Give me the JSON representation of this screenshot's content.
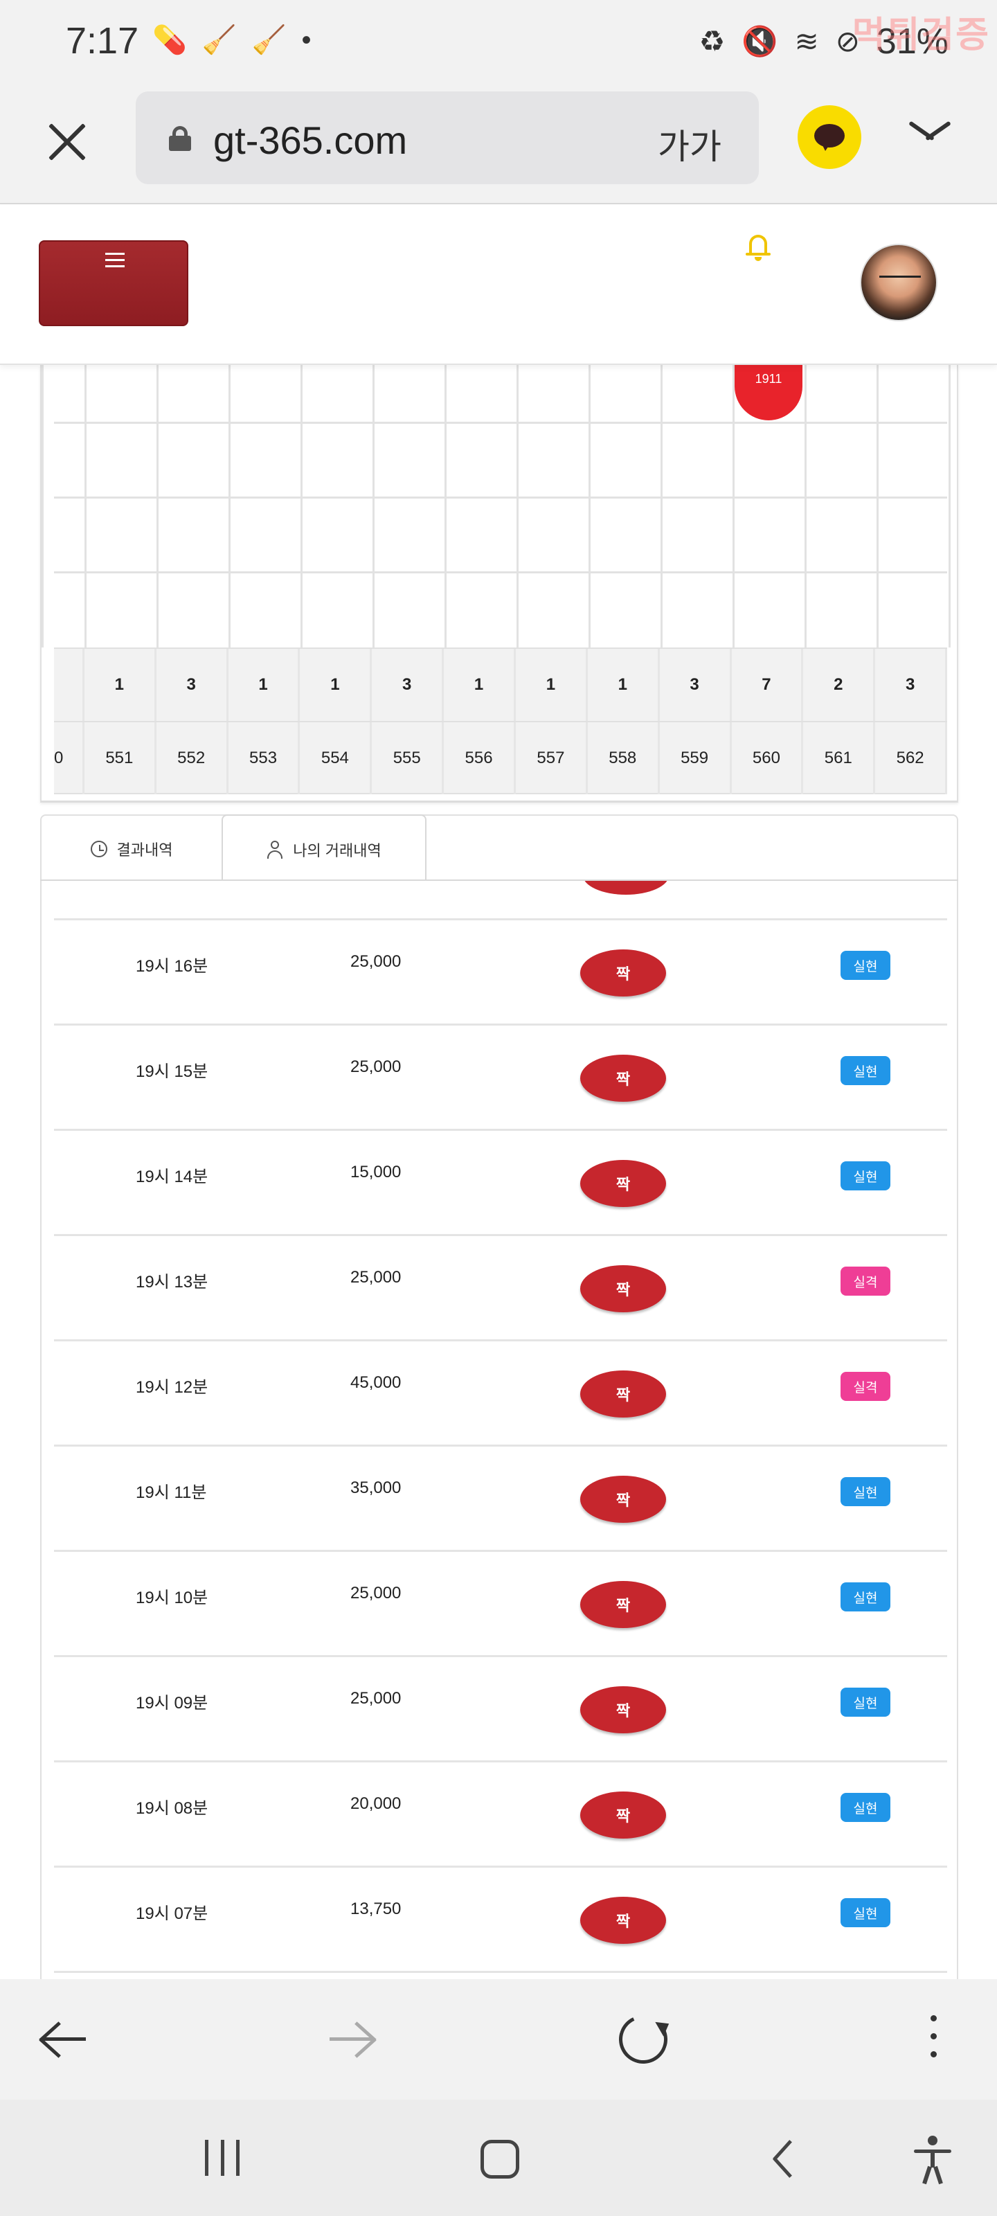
{
  "status_bar": {
    "time": "7:17",
    "battery_percent": "31%",
    "watermark": "먹튀검증",
    "left_icons": [
      "pill-icon",
      "broom-icon",
      "broom-icon",
      "dot-icon"
    ],
    "right_icons": [
      "battery-saver-icon",
      "mute-icon",
      "wifi-icon",
      "do-not-disturb-icon"
    ]
  },
  "url_bar": {
    "url": "gt-365.com",
    "text_size_label": "가가"
  },
  "board": {
    "lead_id": "0",
    "ball_label": "1911",
    "ball_color": "#e8232b",
    "counts": [
      "1",
      "3",
      "1",
      "1",
      "3",
      "1",
      "1",
      "1",
      "3",
      "7",
      "2",
      "3"
    ],
    "ids": [
      "551",
      "552",
      "553",
      "554",
      "555",
      "556",
      "557",
      "558",
      "559",
      "560",
      "561",
      "562"
    ]
  },
  "tabs": {
    "results_label": "결과내역",
    "mine_label": "나의 거래내역",
    "active": "mine"
  },
  "transactions": [
    {
      "time": "19시 16분",
      "amount": "25,000",
      "pick": "짝",
      "status": "실현",
      "status_type": "win"
    },
    {
      "time": "19시 15분",
      "amount": "25,000",
      "pick": "짝",
      "status": "실현",
      "status_type": "win"
    },
    {
      "time": "19시 14분",
      "amount": "15,000",
      "pick": "짝",
      "status": "실현",
      "status_type": "win"
    },
    {
      "time": "19시 13분",
      "amount": "25,000",
      "pick": "짝",
      "status": "실격",
      "status_type": "lose"
    },
    {
      "time": "19시 12분",
      "amount": "45,000",
      "pick": "짝",
      "status": "실격",
      "status_type": "lose"
    },
    {
      "time": "19시 11분",
      "amount": "35,000",
      "pick": "짝",
      "status": "실현",
      "status_type": "win"
    },
    {
      "time": "19시 10분",
      "amount": "25,000",
      "pick": "짝",
      "status": "실현",
      "status_type": "win"
    },
    {
      "time": "19시 09분",
      "amount": "25,000",
      "pick": "짝",
      "status": "실현",
      "status_type": "win"
    },
    {
      "time": "19시 08분",
      "amount": "20,000",
      "pick": "짝",
      "status": "실현",
      "status_type": "win"
    },
    {
      "time": "19시 07분",
      "amount": "13,750",
      "pick": "짝",
      "status": "실현",
      "status_type": "win"
    }
  ],
  "colors": {
    "pick_pill": "#c6262d",
    "status_win": "#2196e8",
    "status_lose": "#ef3e96",
    "menu_button": "#9b2228",
    "bell": "#f0c400",
    "kakao": "#f9dc00"
  }
}
